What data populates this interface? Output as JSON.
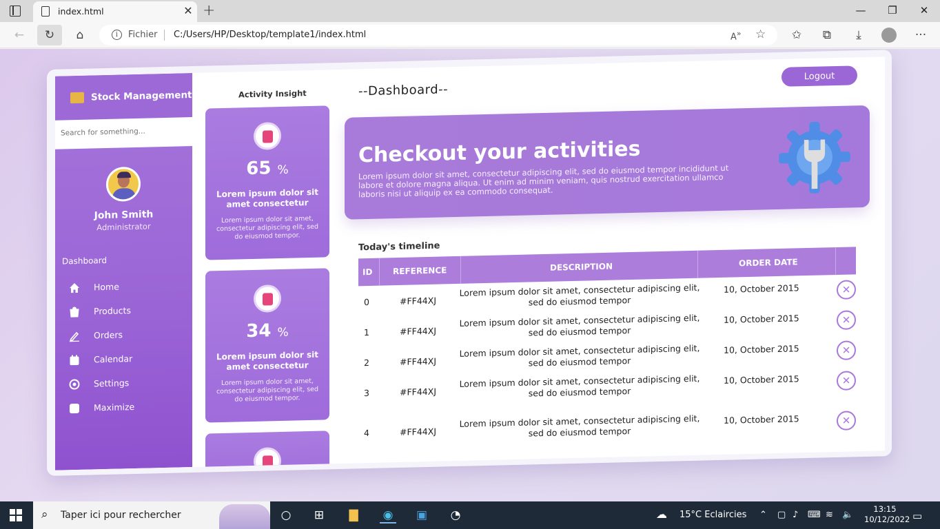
{
  "browser": {
    "tab_title": "index.html",
    "address_scheme": "Fichier",
    "address_url": "C:/Users/HP/Desktop/template1/index.html"
  },
  "sidebar": {
    "brand": "Stock Management",
    "search_placeholder": "Search for something...",
    "user_name": "John Smith",
    "user_role": "Administrator",
    "section_title": "Dashboard",
    "items": [
      {
        "label": "Home",
        "icon": "home-icon"
      },
      {
        "label": "Products",
        "icon": "products-icon"
      },
      {
        "label": "Orders",
        "icon": "orders-icon"
      },
      {
        "label": "Calendar",
        "icon": "calendar-icon"
      },
      {
        "label": "Settings",
        "icon": "settings-icon"
      },
      {
        "label": "Maximize",
        "icon": "maximize-icon"
      }
    ]
  },
  "activity": {
    "title": "Activity Insight",
    "cards": [
      {
        "value": "65",
        "unit": "%",
        "title": "Lorem ipsum dolor sit amet consectetur",
        "desc": "Lorem ipsum dolor sit amet, consectetur adipiscing elit, sed do eiusmod tempor."
      },
      {
        "value": "34",
        "unit": "%",
        "title": "Lorem ipsum dolor sit amet consectetur",
        "desc": "Lorem ipsum dolor sit amet, consectetur adipiscing elit, sed do eiusmod tempor."
      }
    ]
  },
  "main": {
    "title": "--Dashboard--",
    "logout_label": "Logout",
    "hero_title": "Checkout your activities",
    "hero_text": "Lorem ipsum dolor sit amet, consectetur adipiscing elit, sed do eiusmod tempor incididunt ut labore et dolore magna aliqua. Ut enim ad minim veniam, quis nostrud exercitation ullamco laboris nisi ut aliquip ex ea commodo consequat.",
    "timeline_title": "Today's timeline",
    "columns": [
      "ID",
      "REFERENCE",
      "DESCRIPTION",
      "ORDER DATE"
    ],
    "rows": [
      {
        "id": "0",
        "ref": "#FF44XJ",
        "desc": "Lorem ipsum dolor sit amet, consectetur adipiscing elit, sed do eiusmod tempor",
        "date": "10, October 2015"
      },
      {
        "id": "1",
        "ref": "#FF44XJ",
        "desc": "Lorem ipsum dolor sit amet, consectetur adipiscing elit, sed do eiusmod tempor",
        "date": "10, October 2015"
      },
      {
        "id": "2",
        "ref": "#FF44XJ",
        "desc": "Lorem ipsum dolor sit amet, consectetur adipiscing elit, sed do eiusmod tempor",
        "date": "10, October 2015"
      },
      {
        "id": "3",
        "ref": "#FF44XJ",
        "desc": "Lorem ipsum dolor sit amet, consectetur adipiscing elit, sed do eiusmod tempor",
        "date": "10, October 2015"
      },
      {
        "id": "4",
        "ref": "#FF44XJ",
        "desc": "Lorem ipsum dolor sit amet, consectetur adipiscing elit, sed do eiusmod tempor",
        "date": "10, October 2015"
      }
    ]
  },
  "taskbar": {
    "search_text": "Taper ici pour rechercher",
    "weather": "15°C  Eclaircies",
    "time": "13:15",
    "date": "10/12/2022"
  },
  "colors": {
    "accent": "#a06dd9",
    "sidebar": "#9a64d6",
    "taskbar": "#1f2a38"
  }
}
